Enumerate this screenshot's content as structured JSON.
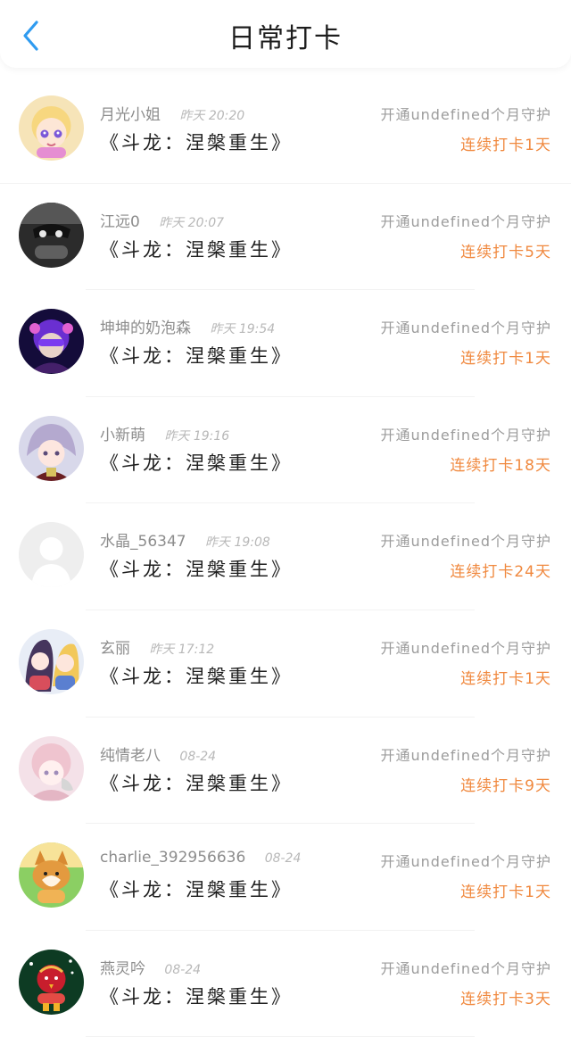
{
  "header": {
    "title": "日常打卡",
    "back_icon": "chevron-left-icon",
    "accent": "#2f9bf0"
  },
  "colors": {
    "streak": "#f0893f",
    "meta": "#b8b8b8"
  },
  "items": [
    {
      "name": "月光小姐",
      "time": "昨天 20:20",
      "novel": "《斗龙：涅槃重生》",
      "guard": "开通undefined个月守护",
      "streak": "连续打卡1天",
      "avatar_icon": "anime-girl-avatar"
    },
    {
      "name": "江远0",
      "time": "昨天 20:07",
      "novel": "《斗龙：涅槃重生》",
      "guard": "开通undefined个月守护",
      "streak": "连续打卡5天",
      "avatar_icon": "dark-character-avatar"
    },
    {
      "name": "坤坤的奶泡森",
      "time": "昨天 19:54",
      "novel": "《斗龙：涅槃重生》",
      "guard": "开通undefined个月守护",
      "streak": "连续打卡1天",
      "avatar_icon": "purple-character-avatar"
    },
    {
      "name": "小新萌",
      "time": "昨天 19:16",
      "novel": "《斗龙：涅槃重生》",
      "guard": "开通undefined个月守护",
      "streak": "连续打卡18天",
      "avatar_icon": "anime-character-avatar"
    },
    {
      "name": "水晶_56347",
      "time": "昨天 19:08",
      "novel": "《斗龙：涅槃重生》",
      "guard": "开通undefined个月守护",
      "streak": "连续打卡24天",
      "avatar_icon": "default-user-avatar"
    },
    {
      "name": "玄丽",
      "time": "昨天 17:12",
      "novel": "《斗龙：涅槃重生》",
      "guard": "开通undefined个月守护",
      "streak": "连续打卡1天",
      "avatar_icon": "anime-couple-avatar"
    },
    {
      "name": "纯情老八",
      "time": "08-24",
      "novel": "《斗龙：涅槃重生》",
      "guard": "开通undefined个月守护",
      "streak": "连续打卡9天",
      "avatar_icon": "pink-anime-avatar"
    },
    {
      "name": "charlie_392956636",
      "time": "08-24",
      "novel": "《斗龙：涅槃重生》",
      "guard": "开通undefined个月守护",
      "streak": "连续打卡1天",
      "avatar_icon": "corgi-avatar"
    },
    {
      "name": "燕灵吟",
      "time": "08-24",
      "novel": "《斗龙：涅槃重生》",
      "guard": "开通undefined个月守护",
      "streak": "连续打卡3天",
      "avatar_icon": "holiday-bird-avatar"
    }
  ]
}
